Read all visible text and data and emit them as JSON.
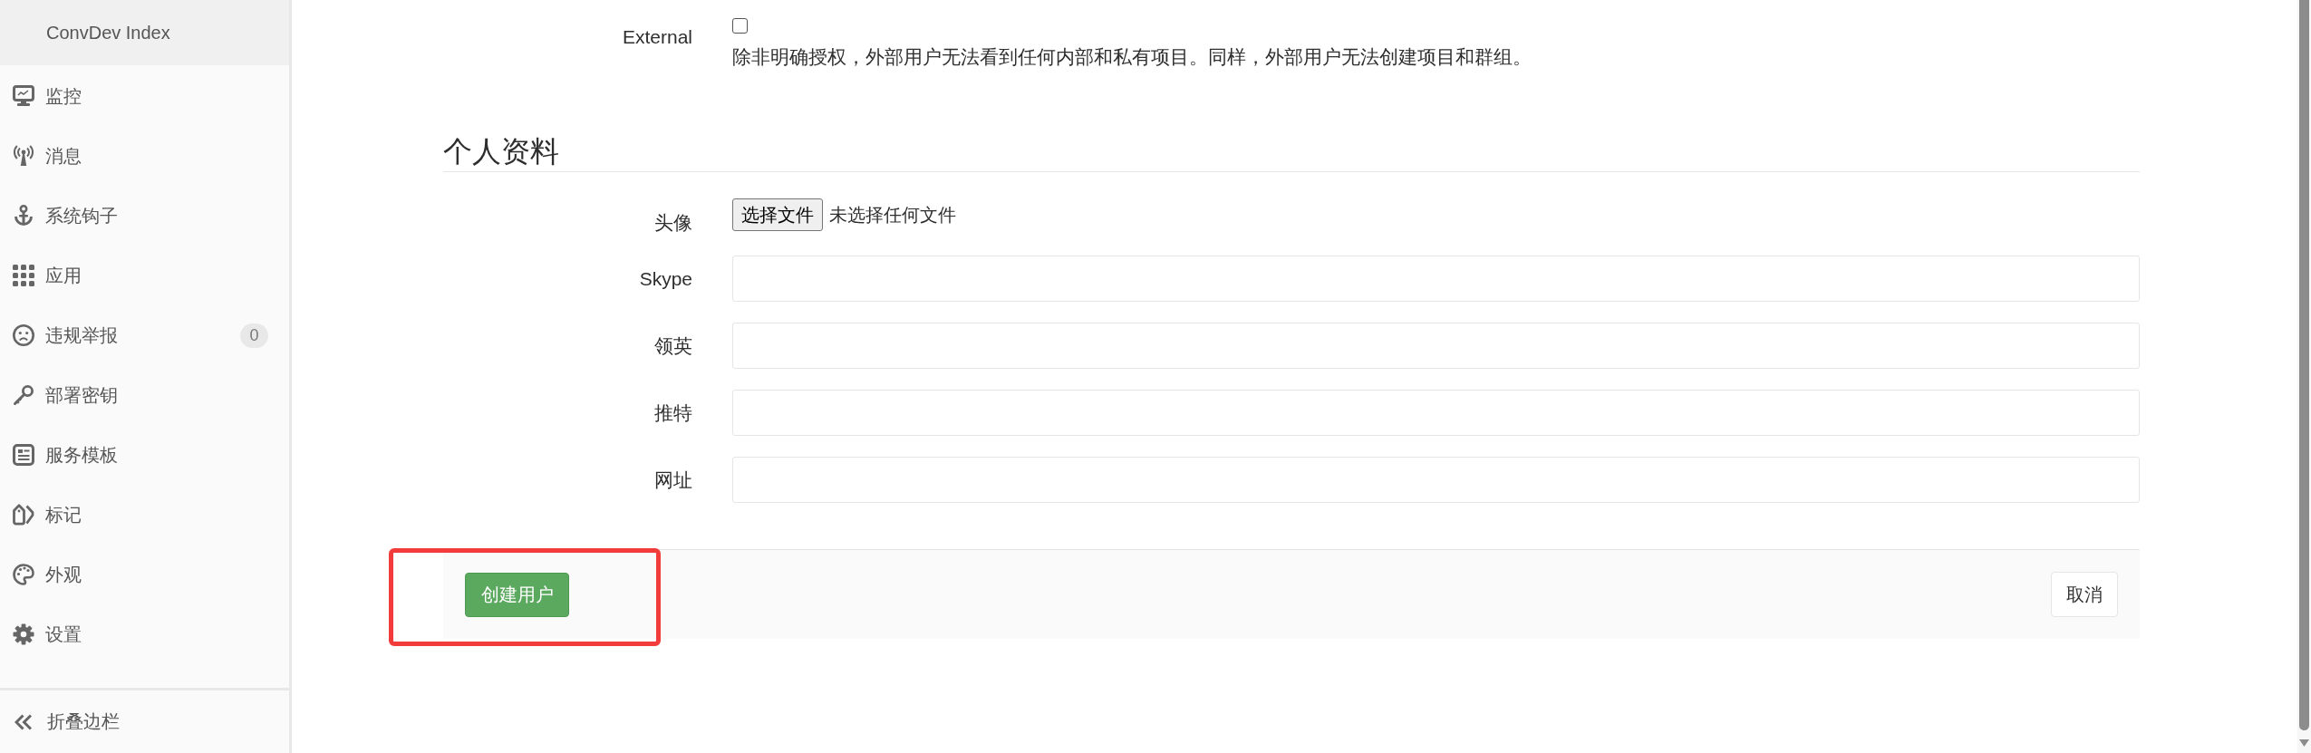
{
  "sidebar": {
    "title": "ConvDev Index",
    "items": [
      {
        "label": "监控",
        "selected": false
      },
      {
        "label": "消息",
        "selected": false
      },
      {
        "label": "系统钩子",
        "selected": false
      },
      {
        "label": "应用",
        "selected": false
      },
      {
        "label": "违规举报",
        "selected": false,
        "badge": "0"
      },
      {
        "label": "部署密钥",
        "selected": false
      },
      {
        "label": "服务模板",
        "selected": false
      },
      {
        "label": "标记",
        "selected": false
      },
      {
        "label": "外观",
        "selected": false
      },
      {
        "label": "设置",
        "selected": false
      }
    ],
    "collapse": "折叠边栏"
  },
  "form": {
    "external": {
      "label": "External",
      "checked": false,
      "help": "除非明确授权，外部用户无法看到任何内部和私有项目。同样，外部用户无法创建项目和群组。"
    },
    "section_title": "个人资料",
    "avatar": {
      "label": "头像",
      "button": "选择文件",
      "status": "未选择任何文件"
    },
    "fields": [
      {
        "label": "Skype"
      },
      {
        "label": "领英"
      },
      {
        "label": "推特"
      },
      {
        "label": "网址"
      }
    ]
  },
  "footer": {
    "submit": {
      "label": "创建用户",
      "highlighted": true
    },
    "cancel": "取消"
  }
}
